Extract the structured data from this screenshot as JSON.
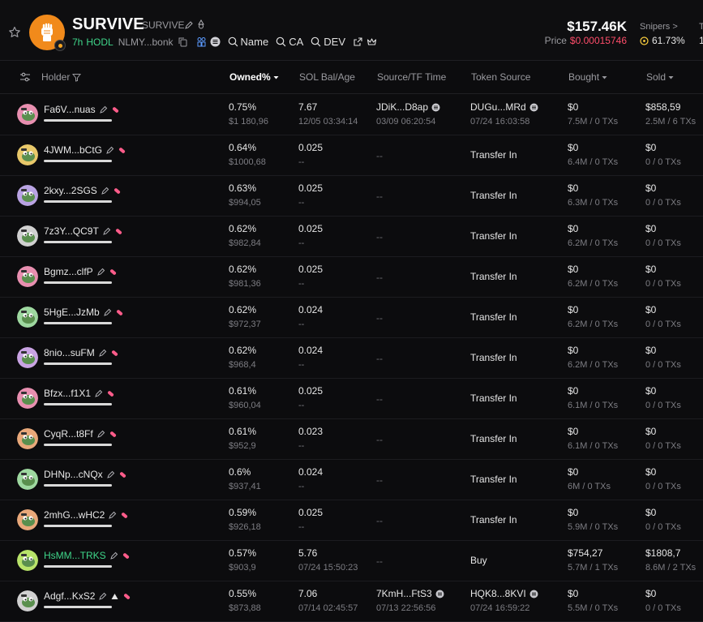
{
  "token": {
    "name": "SURVIVE",
    "ticker": "SURVIVE",
    "age": "7h",
    "hodl_label": "HODL",
    "address": "NLMY...bonk",
    "search_links": [
      "Name",
      "CA",
      "DEV"
    ],
    "market_cap": "$157.46K",
    "price_label": "Price",
    "price": "$0.00015746",
    "snipers_label": "Snipers >",
    "snipers_pct": "61.73%"
  },
  "columns": {
    "holder": "Holder",
    "owned": "Owned%",
    "sol_bal": "SOL Bal/Age",
    "source_tf": "Source/TF Time",
    "token_source": "Token Source",
    "bought": "Bought",
    "sold": "Sold"
  },
  "colors": {
    "accent_green": "#3fd68a",
    "price_red": "#ff4d6a",
    "brand_orange": "#f18a1b",
    "tag_pink": "#ff5c8a"
  },
  "rows": [
    {
      "holder": "Fa6V...nuas",
      "owned": "0.75%",
      "usd": "$1 180,96",
      "sol": "7.67",
      "age": "12/05 03:34:14",
      "src": "JDiK...D8ap",
      "src_time": "03/09 06:20:54",
      "tsrc": "DUGu...MRd",
      "tsrc_time": "07/24 16:03:58",
      "bought": "$0",
      "bought_sub": "7.5M / 0 TXs",
      "sold": "$858,59",
      "sold_sub": "2.5M / 6 TXs"
    },
    {
      "holder": "4JWM...bCtG",
      "owned": "0.64%",
      "usd": "$1000,68",
      "sol": "0.025",
      "age": "--",
      "src": "--",
      "tsrc": "Transfer In",
      "bought": "$0",
      "bought_sub": "6.4M / 0 TXs",
      "sold": "$0",
      "sold_sub": "0 / 0 TXs"
    },
    {
      "holder": "2kxy...2SGS",
      "owned": "0.63%",
      "usd": "$994,05",
      "sol": "0.025",
      "age": "--",
      "src": "--",
      "tsrc": "Transfer In",
      "bought": "$0",
      "bought_sub": "6.3M / 0 TXs",
      "sold": "$0",
      "sold_sub": "0 / 0 TXs"
    },
    {
      "holder": "7z3Y...QC9T",
      "owned": "0.62%",
      "usd": "$982,84",
      "sol": "0.025",
      "age": "--",
      "src": "--",
      "tsrc": "Transfer In",
      "bought": "$0",
      "bought_sub": "6.2M / 0 TXs",
      "sold": "$0",
      "sold_sub": "0 / 0 TXs"
    },
    {
      "holder": "Bgmz...clfP",
      "owned": "0.62%",
      "usd": "$981,36",
      "sol": "0.025",
      "age": "--",
      "src": "--",
      "tsrc": "Transfer In",
      "bought": "$0",
      "bought_sub": "6.2M / 0 TXs",
      "sold": "$0",
      "sold_sub": "0 / 0 TXs"
    },
    {
      "holder": "5HgE...JzMb",
      "owned": "0.62%",
      "usd": "$972,37",
      "sol": "0.024",
      "age": "--",
      "src": "--",
      "tsrc": "Transfer In",
      "bought": "$0",
      "bought_sub": "6.2M / 0 TXs",
      "sold": "$0",
      "sold_sub": "0 / 0 TXs"
    },
    {
      "holder": "8nio...suFM",
      "owned": "0.62%",
      "usd": "$968,4",
      "sol": "0.024",
      "age": "--",
      "src": "--",
      "tsrc": "Transfer In",
      "bought": "$0",
      "bought_sub": "6.2M / 0 TXs",
      "sold": "$0",
      "sold_sub": "0 / 0 TXs"
    },
    {
      "holder": "Bfzx...f1X1",
      "owned": "0.61%",
      "usd": "$960,04",
      "sol": "0.025",
      "age": "--",
      "src": "--",
      "tsrc": "Transfer In",
      "bought": "$0",
      "bought_sub": "6.1M / 0 TXs",
      "sold": "$0",
      "sold_sub": "0 / 0 TXs"
    },
    {
      "holder": "CyqR...t8Ff",
      "owned": "0.61%",
      "usd": "$952,9",
      "sol": "0.023",
      "age": "--",
      "src": "--",
      "tsrc": "Transfer In",
      "bought": "$0",
      "bought_sub": "6.1M / 0 TXs",
      "sold": "$0",
      "sold_sub": "0 / 0 TXs"
    },
    {
      "holder": "DHNp...cNQx",
      "owned": "0.6%",
      "usd": "$937,41",
      "sol": "0.024",
      "age": "--",
      "src": "--",
      "tsrc": "Transfer In",
      "bought": "$0",
      "bought_sub": "6M / 0 TXs",
      "sold": "$0",
      "sold_sub": "0 / 0 TXs"
    },
    {
      "holder": "2mhG...wHC2",
      "owned": "0.59%",
      "usd": "$926,18",
      "sol": "0.025",
      "age": "--",
      "src": "--",
      "tsrc": "Transfer In",
      "bought": "$0",
      "bought_sub": "5.9M / 0 TXs",
      "sold": "$0",
      "sold_sub": "0 / 0 TXs"
    },
    {
      "holder": "HsMM...TRKS",
      "owned": "0.57%",
      "usd": "$903,9",
      "sol": "5.76",
      "age": "07/24 15:50:23",
      "src": "--",
      "tsrc": "Buy",
      "bought": "$754,27",
      "bought_sub": "5.7M / 1 TXs",
      "sold": "$1808,7",
      "sold_sub": "8.6M / 2 TXs"
    },
    {
      "holder": "Adgf...KxS2",
      "owned": "0.55%",
      "usd": "$873,88",
      "sol": "7.06",
      "age": "07/14 02:45:57",
      "src": "7KmH...FtS3",
      "src_time": "07/13 22:56:56",
      "tsrc": "HQK8...8KVI",
      "tsrc_time": "07/24 16:59:22",
      "bought": "$0",
      "bought_sub": "5.5M / 0 TXs",
      "sold": "$0",
      "sold_sub": "0 / 0 TXs"
    }
  ]
}
